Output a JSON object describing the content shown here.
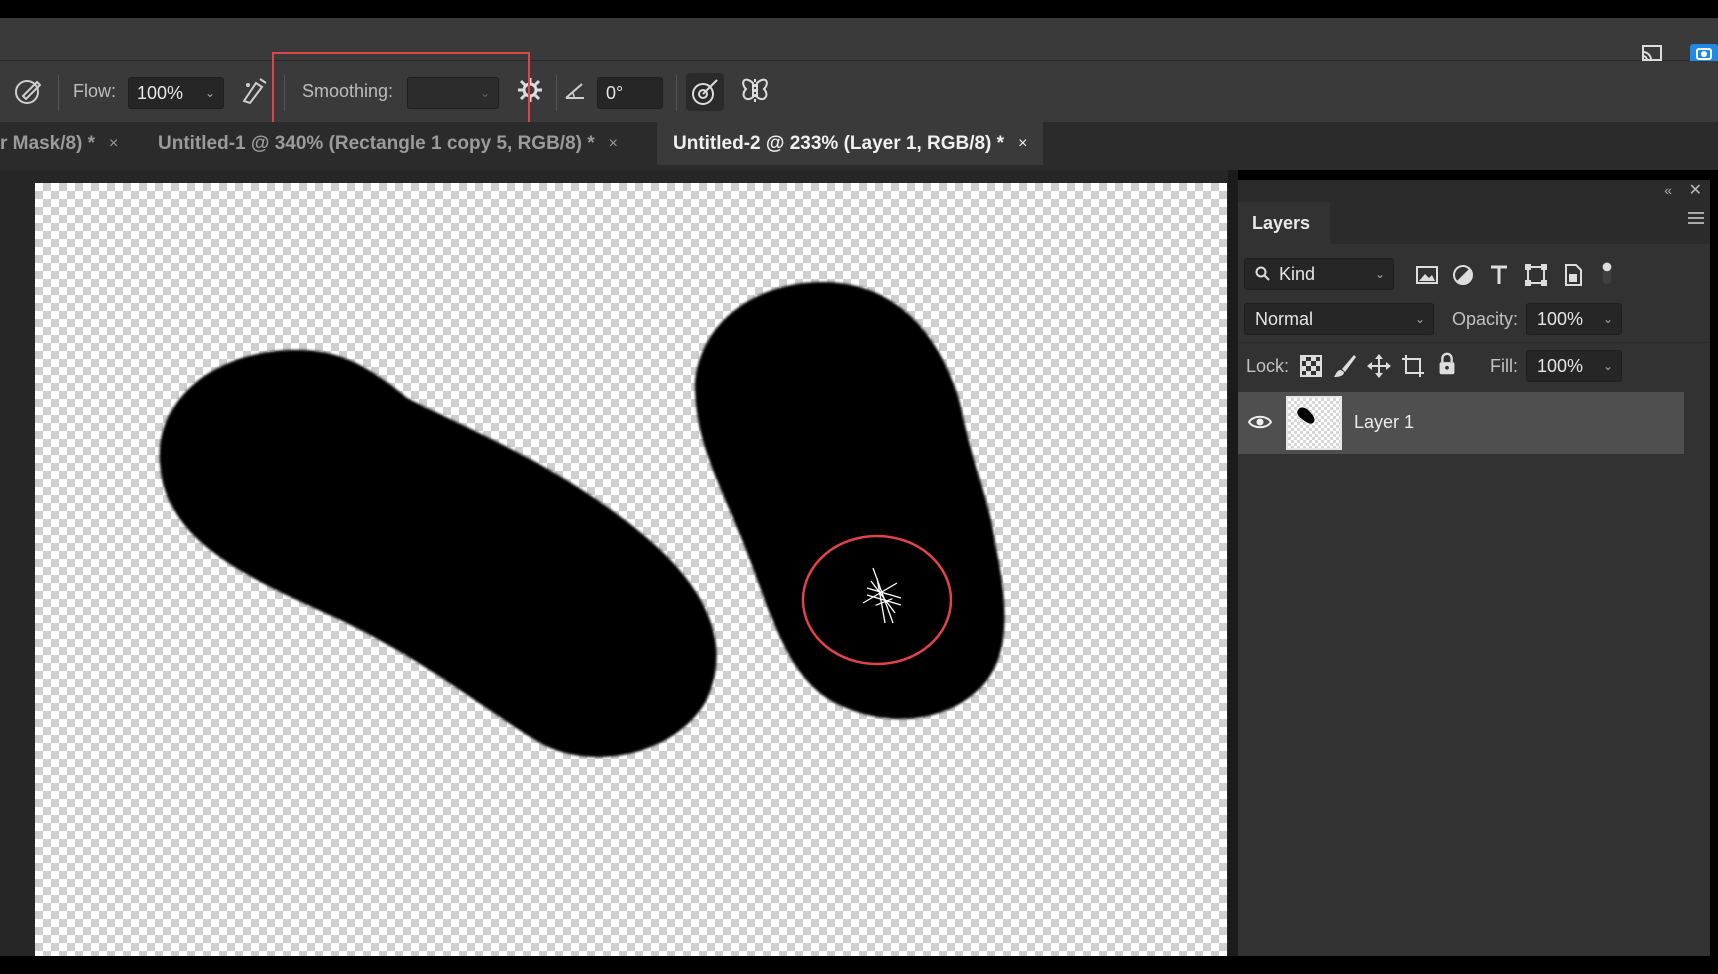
{
  "topbar": {
    "cast_icon": "cast-icon",
    "camera_icon": "camera-icon"
  },
  "options": {
    "flow_label": "Flow:",
    "flow_value": "100%",
    "smoothing_label": "Smoothing:",
    "smoothing_value": "",
    "angle_value": "0°",
    "highlight_color": "#e0434a"
  },
  "tabs": [
    {
      "label": "r Mask/8) *",
      "active": false
    },
    {
      "label": "Untitled-1 @ 340% (Rectangle 1 copy 5, RGB/8) *",
      "active": false
    },
    {
      "label": "Untitled-2 @ 233% (Layer 1, RGB/8) *",
      "active": true
    }
  ],
  "tab_close": "×",
  "layers_panel": {
    "title": "Layers",
    "filter_label": "Kind",
    "blend_mode": "Normal",
    "opacity_label": "Opacity:",
    "opacity_value": "100%",
    "lock_label": "Lock:",
    "fill_label": "Fill:",
    "fill_value": "100%",
    "layers": [
      {
        "name": "Layer 1",
        "visible": true,
        "selected": true
      }
    ]
  },
  "canvas": {
    "cursor_highlight_color": "#e0434a",
    "shape_color": "#000000"
  }
}
